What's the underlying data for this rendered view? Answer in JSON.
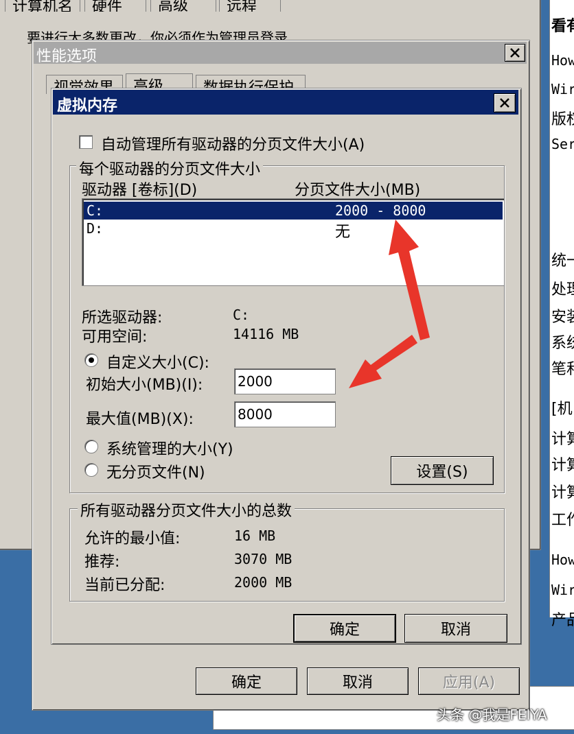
{
  "background_window": {
    "tabs": [
      "计算机名",
      "硬件",
      "高级",
      "远程"
    ],
    "partial_text": "要进行大多数更改，你必须作为管理员登录"
  },
  "right_panel_text": [
    "看有",
    "How",
    "Wir",
    "版权",
    "Ser",
    "统一",
    "处理",
    "安装",
    "系统",
    "笔和",
    "[机",
    "计算",
    "计算",
    "计算",
    "工作",
    "How",
    "Wir",
    "产品"
  ],
  "perf_window": {
    "title": "性能选项",
    "tabs": [
      "视觉效果",
      "高级",
      "数据执行保护"
    ],
    "buttons": {
      "ok": "确定",
      "cancel": "取消",
      "apply": "应用(A)"
    }
  },
  "vm_dialog": {
    "title": "虚拟内存",
    "auto_manage_label": "自动管理所有驱动器的分页文件大小(A)",
    "auto_manage_checked": false,
    "per_drive_group": "每个驱动器的分页文件大小",
    "col_drive": "驱动器 [卷标](D)",
    "col_size": "分页文件大小(MB)",
    "drives": [
      {
        "drive": "C:",
        "size": "2000 - 8000",
        "selected": true
      },
      {
        "drive": "D:",
        "size": "无",
        "selected": false
      }
    ],
    "selected_drive_label": "所选驱动器:",
    "selected_drive_value": "C:",
    "free_space_label": "可用空间:",
    "free_space_value": "14116 MB",
    "custom_size_label": "自定义大小(C):",
    "initial_size_label": "初始大小(MB)(I):",
    "initial_size_value": "2000",
    "max_size_label": "最大值(MB)(X):",
    "max_size_value": "8000",
    "system_managed_label": "系统管理的大小(Y)",
    "no_paging_label": "无分页文件(N)",
    "set_button": "设置(S)",
    "total_group": "所有驱动器分页文件大小的总数",
    "min_allowed_label": "允许的最小值:",
    "min_allowed_value": "16 MB",
    "recommended_label": "推荐:",
    "recommended_value": "3070 MB",
    "allocated_label": "当前已分配:",
    "allocated_value": "2000 MB",
    "ok_button": "确定",
    "cancel_button": "取消"
  },
  "watermark": "头条 @我是FEIYA",
  "colors": {
    "accent_title": "#0a246a",
    "arrow": "#e8352a",
    "face": "#d4d0c8",
    "desktop": "#3a6ea5"
  }
}
